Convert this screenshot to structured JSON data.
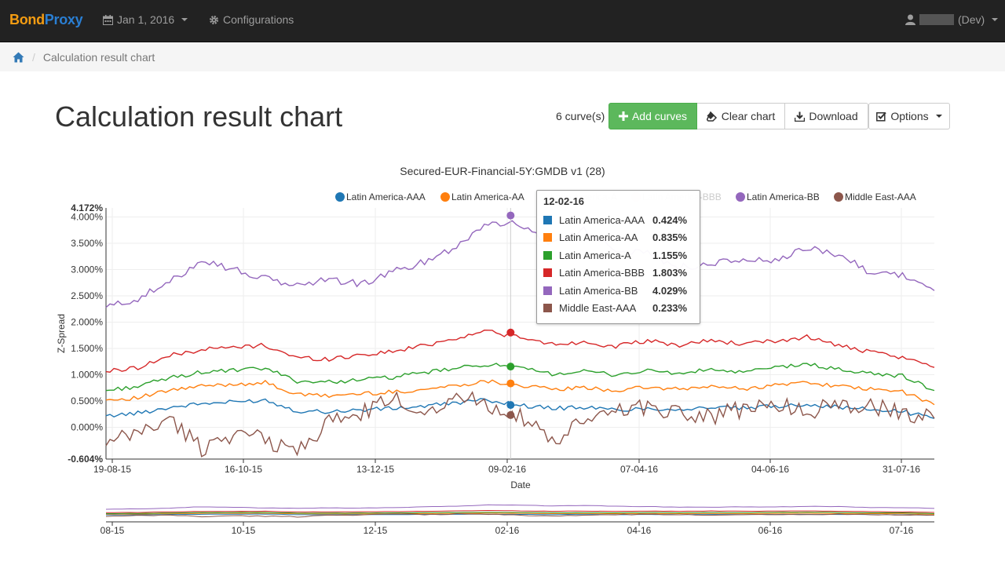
{
  "navbar": {
    "brand_part1": "Bond",
    "brand_part2": "Proxy",
    "date_menu": "Jan 1, 2016",
    "config_label": "Configurations",
    "user_suffix": "(Dev)"
  },
  "breadcrumb": {
    "current": "Calculation result chart"
  },
  "page": {
    "title": "Calculation result chart",
    "curve_count": "6 curve(s)",
    "add_curves": "Add curves",
    "clear_chart": "Clear chart",
    "download": "Download",
    "options": "Options"
  },
  "colors": {
    "navbar_bg": "#222222",
    "success": "#5cb85c",
    "series": [
      "#1f77b4",
      "#ff7f0e",
      "#2ca02c",
      "#d62728",
      "#9467bd",
      "#8c564b"
    ]
  },
  "tooltip": {
    "date": "12-02-16",
    "rows": [
      {
        "name": "Latin America-AAA",
        "value": "0.424%"
      },
      {
        "name": "Latin America-AA",
        "value": "0.835%"
      },
      {
        "name": "Latin America-A",
        "value": "1.155%"
      },
      {
        "name": "Latin America-BBB",
        "value": "1.803%"
      },
      {
        "name": "Latin America-BB",
        "value": "4.029%"
      },
      {
        "name": "Middle East-AAA",
        "value": "0.233%"
      }
    ]
  },
  "chart_data": {
    "type": "line",
    "title": "Secured-EUR-Financial-5Y:GMDB v1 (28)",
    "xlabel": "Date",
    "ylabel": "Z-Spread",
    "ylim": [
      -0.604,
      4.172
    ],
    "y_min_label": "-0.604%",
    "y_max_label": "4.172%",
    "y_ticks": [
      "0.000%",
      "0.500%",
      "1.000%",
      "1.500%",
      "2.000%",
      "2.500%",
      "3.000%",
      "3.500%",
      "4.000%"
    ],
    "x_ticks": [
      "19-08-15",
      "16-10-15",
      "13-12-15",
      "09-02-16",
      "07-04-16",
      "04-06-16",
      "31-07-16"
    ],
    "overview_ticks": [
      "08-15",
      "10-15",
      "12-15",
      "02-16",
      "04-16",
      "06-16",
      "07-16"
    ],
    "legend": [
      "Latin America-AAA",
      "Latin America-AA",
      "Latin America-A",
      "Latin America-BBB",
      "Latin America-BB",
      "Middle East-AAA"
    ],
    "legend_faded": [
      false,
      false,
      true,
      true,
      false,
      false
    ],
    "grid": true,
    "legend_position": "top",
    "x_dates": [
      "19-08-15",
      "02-09-15",
      "16-09-15",
      "30-09-15",
      "14-10-15",
      "28-10-15",
      "11-11-15",
      "25-11-15",
      "09-12-15",
      "23-12-15",
      "06-01-16",
      "20-01-16",
      "03-02-16",
      "17-02-16",
      "02-03-16",
      "16-03-16",
      "30-03-16",
      "13-04-16",
      "27-04-16",
      "11-05-16",
      "25-05-16",
      "08-06-16",
      "22-06-16",
      "06-07-16",
      "20-07-16",
      "03-08-16",
      "10-08-16"
    ],
    "series": [
      {
        "name": "Latin America-AAA",
        "values": [
          0.22,
          0.27,
          0.38,
          0.45,
          0.48,
          0.52,
          0.31,
          0.3,
          0.33,
          0.36,
          0.4,
          0.47,
          0.52,
          0.42,
          0.36,
          0.38,
          0.33,
          0.36,
          0.34,
          0.38,
          0.36,
          0.4,
          0.44,
          0.38,
          0.34,
          0.3,
          0.17
        ]
      },
      {
        "name": "Latin America-AA",
        "values": [
          0.52,
          0.56,
          0.7,
          0.78,
          0.82,
          0.85,
          0.62,
          0.6,
          0.64,
          0.67,
          0.72,
          0.8,
          0.88,
          0.8,
          0.72,
          0.75,
          0.7,
          0.76,
          0.72,
          0.78,
          0.73,
          0.8,
          0.86,
          0.78,
          0.72,
          0.68,
          0.43
        ]
      },
      {
        "name": "Latin America-A",
        "values": [
          0.7,
          0.78,
          0.94,
          1.05,
          1.08,
          1.12,
          0.88,
          0.86,
          0.91,
          0.95,
          1.04,
          1.12,
          1.2,
          1.12,
          1.02,
          1.06,
          1.0,
          1.08,
          1.02,
          1.1,
          1.04,
          1.14,
          1.2,
          1.1,
          1.02,
          0.98,
          0.7
        ]
      },
      {
        "name": "Latin America-BBB",
        "values": [
          1.06,
          1.14,
          1.36,
          1.48,
          1.52,
          1.56,
          1.32,
          1.3,
          1.38,
          1.44,
          1.56,
          1.7,
          1.84,
          1.7,
          1.58,
          1.62,
          1.54,
          1.64,
          1.56,
          1.66,
          1.58,
          1.64,
          1.72,
          1.56,
          1.42,
          1.32,
          1.14
        ]
      },
      {
        "name": "Latin America-BB",
        "values": [
          2.28,
          2.45,
          2.75,
          3.2,
          3.0,
          2.82,
          2.7,
          2.82,
          2.72,
          2.95,
          3.15,
          3.45,
          3.9,
          3.85,
          3.5,
          3.75,
          3.4,
          3.3,
          3.05,
          3.1,
          3.2,
          3.15,
          3.4,
          3.3,
          2.95,
          2.9,
          2.6
        ]
      },
      {
        "name": "Middle East-AAA",
        "values": [
          -0.35,
          -0.1,
          0.15,
          -0.4,
          -0.1,
          -0.25,
          -0.45,
          0.1,
          0.25,
          0.55,
          0.3,
          0.6,
          0.45,
          0.2,
          -0.3,
          0.1,
          0.35,
          0.4,
          0.3,
          0.2,
          0.35,
          0.45,
          0.3,
          0.45,
          0.4,
          0.25,
          0.17
        ]
      }
    ],
    "tooltip_x_index": 12.7
  }
}
